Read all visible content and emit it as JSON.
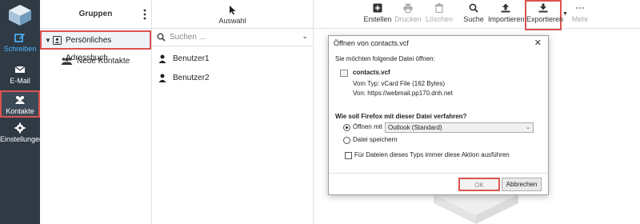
{
  "nav": {
    "items": [
      {
        "label": "Schreiben",
        "icon": "edit-icon"
      },
      {
        "label": "E-Mail",
        "icon": "mail-icon"
      },
      {
        "label": "Kontakte",
        "icon": "contacts-icon"
      },
      {
        "label": "Einstellungen",
        "icon": "gear-icon"
      }
    ]
  },
  "groups": {
    "title": "Gruppen",
    "address_book": "Persönliches Adressbuch",
    "subgroup": "Neue Kontakte"
  },
  "list": {
    "select_label": "Auswahl",
    "search_placeholder": "Suchen ...",
    "contacts": [
      "Benutzer1",
      "Benutzer2"
    ]
  },
  "toolbar": {
    "buttons": [
      {
        "label": "Erstellen",
        "icon": "plus-square-icon",
        "enabled": true
      },
      {
        "label": "Drucken",
        "icon": "print-icon",
        "enabled": false
      },
      {
        "label": "Löschen",
        "icon": "trash-icon",
        "enabled": false
      },
      {
        "label": "Suche",
        "icon": "search-icon",
        "enabled": true
      },
      {
        "label": "Importieren",
        "icon": "upload-icon",
        "enabled": true
      },
      {
        "label": "Exportieren",
        "icon": "download-icon",
        "enabled": true
      },
      {
        "label": "Mehr",
        "icon": "more-icon",
        "enabled": false
      }
    ]
  },
  "dialog": {
    "title": "Öffnen von contacts.vcf",
    "intro": "Sie möchten folgende Datei öffnen:",
    "filename": "contacts.vcf",
    "type_line": "Vom Typ:  vCard File (162 Bytes)",
    "from_line": "Von:  https://webmail.pp170.dnh.net",
    "question": "Wie soll Firefox mit dieser Datei verfahren?",
    "open_with_label": "Öffnen mit",
    "open_with_value": "Outlook (Standard)",
    "save_label": "Datei speichern",
    "always_label": "Für Dateien dieses Typs immer diese Aktion ausführen",
    "ok": "OK",
    "cancel": "Abbrechen"
  },
  "colors": {
    "nav_bg": "#2f3a45",
    "accent": "#4db8ff",
    "highlight": "#d9534f"
  }
}
